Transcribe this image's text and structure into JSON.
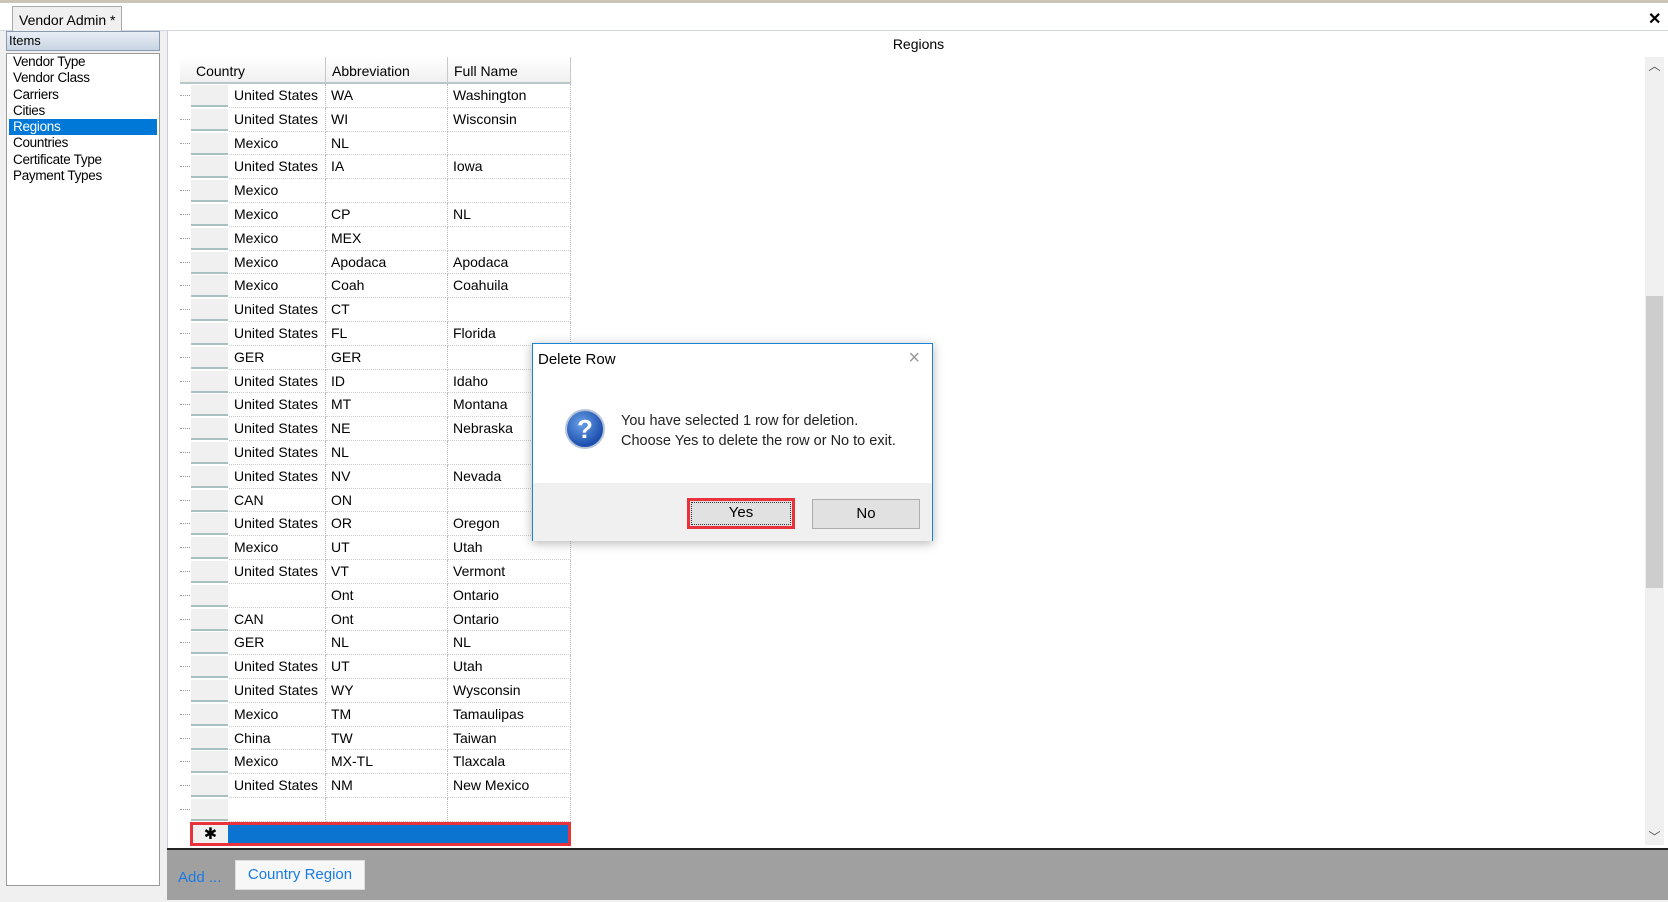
{
  "window": {
    "tab_label": "Vendor Admin *",
    "close_icon": "close-icon"
  },
  "sidebar": {
    "header": "Items",
    "items": [
      {
        "label": "Vendor Type"
      },
      {
        "label": "Vendor Class"
      },
      {
        "label": "Carriers"
      },
      {
        "label": "Cities"
      },
      {
        "label": "Regions",
        "selected": true
      },
      {
        "label": "Countries"
      },
      {
        "label": "Certificate Type"
      },
      {
        "label": "Payment Types"
      }
    ]
  },
  "main": {
    "title": "Regions",
    "columns": [
      "Country",
      "Abbreviation",
      "Full Name"
    ],
    "rows": [
      [
        "United States",
        "WA",
        "Washington"
      ],
      [
        "United States",
        "WI",
        "Wisconsin"
      ],
      [
        "Mexico",
        "NL",
        ""
      ],
      [
        "United States",
        "IA",
        "Iowa"
      ],
      [
        "Mexico",
        "",
        ""
      ],
      [
        "Mexico",
        "CP",
        "NL"
      ],
      [
        "Mexico",
        "MEX",
        ""
      ],
      [
        "Mexico",
        "Apodaca",
        "Apodaca"
      ],
      [
        "Mexico",
        "Coah",
        "Coahuila"
      ],
      [
        "United States",
        "CT",
        ""
      ],
      [
        "United States",
        "FL",
        "Florida"
      ],
      [
        "GER",
        "GER",
        ""
      ],
      [
        "United States",
        "ID",
        "Idaho"
      ],
      [
        "United States",
        "MT",
        "Montana"
      ],
      [
        "United States",
        "NE",
        "Nebraska"
      ],
      [
        "United States",
        "NL",
        ""
      ],
      [
        "United States",
        "NV",
        "Nevada"
      ],
      [
        "CAN",
        "ON",
        ""
      ],
      [
        "United States",
        "OR",
        "Oregon"
      ],
      [
        "Mexico",
        "UT",
        "Utah"
      ],
      [
        "United States",
        "VT",
        "Vermont"
      ],
      [
        "",
        "Ont",
        "Ontario"
      ],
      [
        "CAN",
        "Ont",
        "Ontario"
      ],
      [
        "GER",
        "NL",
        "NL"
      ],
      [
        "United States",
        "UT",
        "Utah"
      ],
      [
        "United States",
        "WY",
        "Wysconsin"
      ],
      [
        "Mexico",
        "TM",
        "Tamaulipas"
      ],
      [
        "China",
        "TW",
        "Taiwan"
      ],
      [
        "Mexico",
        "MX-TL",
        "Tlaxcala"
      ],
      [
        "United States",
        "NM",
        "New Mexico"
      ],
      [
        "",
        "",
        ""
      ]
    ],
    "new_row_marker": "✱"
  },
  "bottom": {
    "add_label": "Add ...",
    "country_region_label": "Country Region"
  },
  "dialog": {
    "title": "Delete Row",
    "line1": "You have selected 1 row for deletion.",
    "line2": "Choose Yes to delete the row or No to exit.",
    "yes": "Yes",
    "no": "No",
    "icon": "question-icon"
  },
  "colors": {
    "selection": "#0078d7",
    "highlight_border": "#e8323c",
    "link": "#1a7be0"
  }
}
